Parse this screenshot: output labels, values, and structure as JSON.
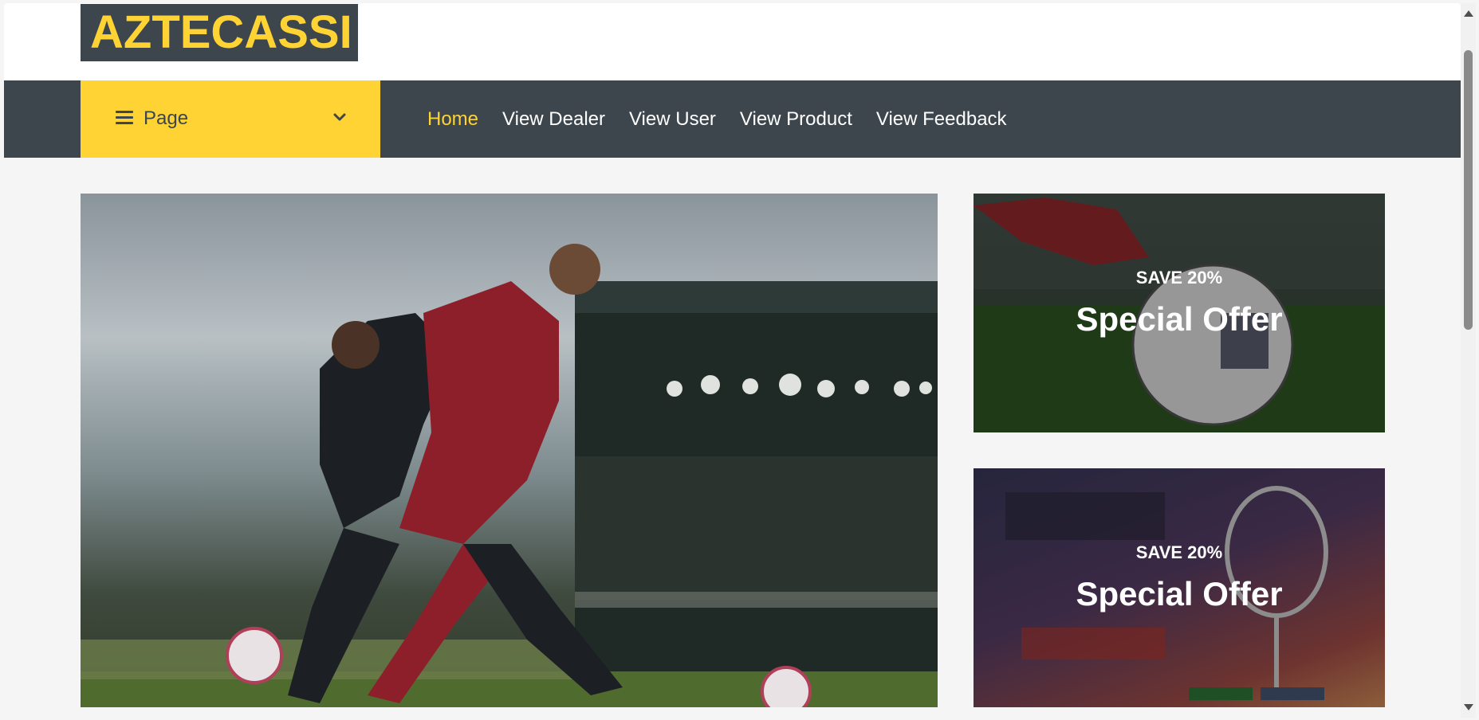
{
  "brand": {
    "logo_text": "AZTECASSI"
  },
  "categories": {
    "label": "Page"
  },
  "nav": {
    "links": [
      {
        "label": "Home",
        "active": true
      },
      {
        "label": "View Dealer",
        "active": false
      },
      {
        "label": "View User",
        "active": false
      },
      {
        "label": "View Product",
        "active": false
      },
      {
        "label": "View Feedback",
        "active": false
      }
    ]
  },
  "offers": [
    {
      "save": "SAVE 20%",
      "title": "Special Offer",
      "image": "soccer-ball-on-pitch"
    },
    {
      "save": "SAVE 20%",
      "title": "Special Offer",
      "image": "badminton-racket-poster"
    }
  ],
  "hero": {
    "image": "soccer-players-running"
  },
  "colors": {
    "accent": "#ffd333",
    "dark": "#3d464d",
    "background": "#f5f5f5"
  }
}
